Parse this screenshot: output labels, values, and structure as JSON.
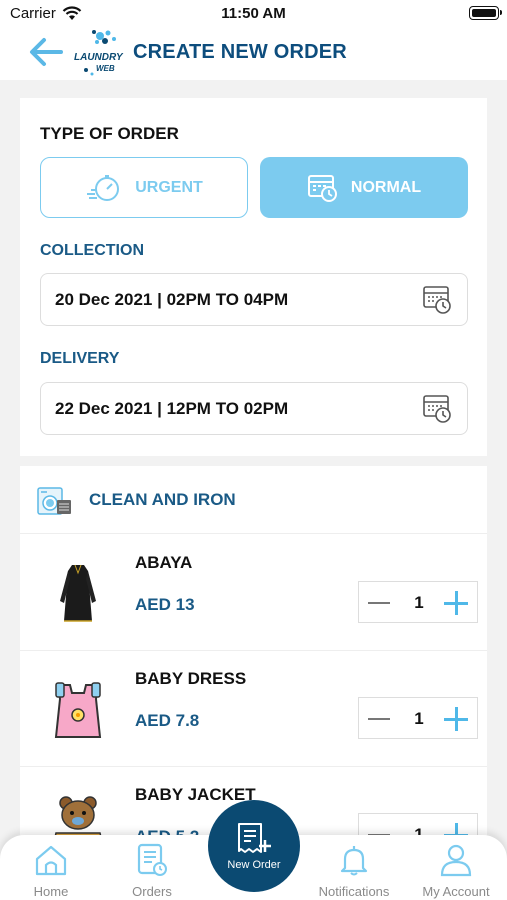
{
  "status": {
    "carrier": "Carrier",
    "time": "11:50 AM"
  },
  "header": {
    "title": "CREATE NEW ORDER",
    "logo_text_top": "LAUNDRY",
    "logo_text_bottom": "WEB"
  },
  "order": {
    "type_title": "TYPE OF ORDER",
    "urgent_label": "URGENT",
    "normal_label": "NORMAL",
    "selected": "NORMAL",
    "collection_label": "COLLECTION",
    "collection_value": "20 Dec 2021 | 02PM TO 04PM",
    "delivery_label": "DELIVERY",
    "delivery_value": "22 Dec 2021 | 12PM TO 02PM"
  },
  "category": {
    "label": "CLEAN AND IRON"
  },
  "items": [
    {
      "name": "ABAYA",
      "price": "AED 13",
      "qty": "1"
    },
    {
      "name": "BABY DRESS",
      "price": "AED 7.8",
      "qty": "1"
    },
    {
      "name": "BABY JACKET",
      "price": "AED 5.2",
      "qty": "1"
    }
  ],
  "tabbar": {
    "home": "Home",
    "orders": "Orders",
    "new_order": "New Order",
    "notifications": "Notifications",
    "account": "My Account"
  },
  "colors": {
    "primary": "#0b4a72",
    "accent": "#7ccbef",
    "text_blue": "#1a5a86"
  }
}
